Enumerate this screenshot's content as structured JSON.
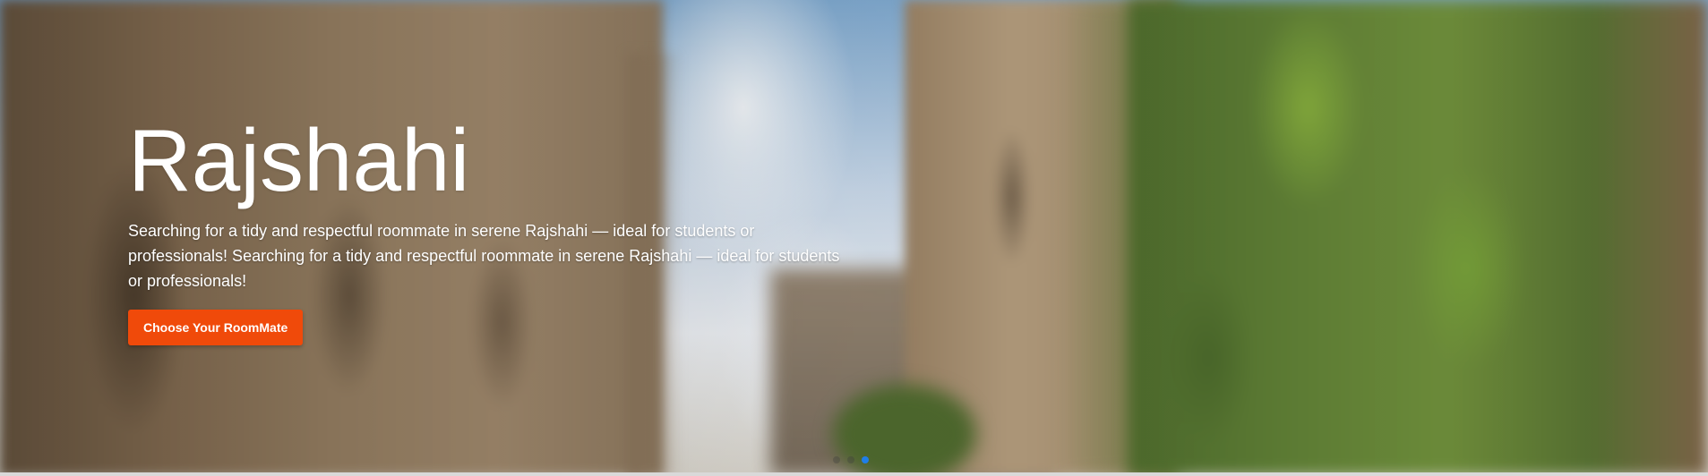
{
  "hero": {
    "title": "Rajshahi",
    "description": "Searching for a tidy and respectful roommate in serene Rajshahi — ideal for students or professionals! Searching for a tidy and respectful roommate in serene Rajshahi — ideal for students or professionals!",
    "cta_label": "Choose Your RoomMate",
    "background_image": "blurred-stone-street-with-ivy-photo"
  },
  "carousel": {
    "slide_count": 3,
    "active_slide": 3
  },
  "colors": {
    "cta_background": "#f04a0a",
    "active_dot": "#1f7ee8",
    "text": "#ffffff"
  }
}
